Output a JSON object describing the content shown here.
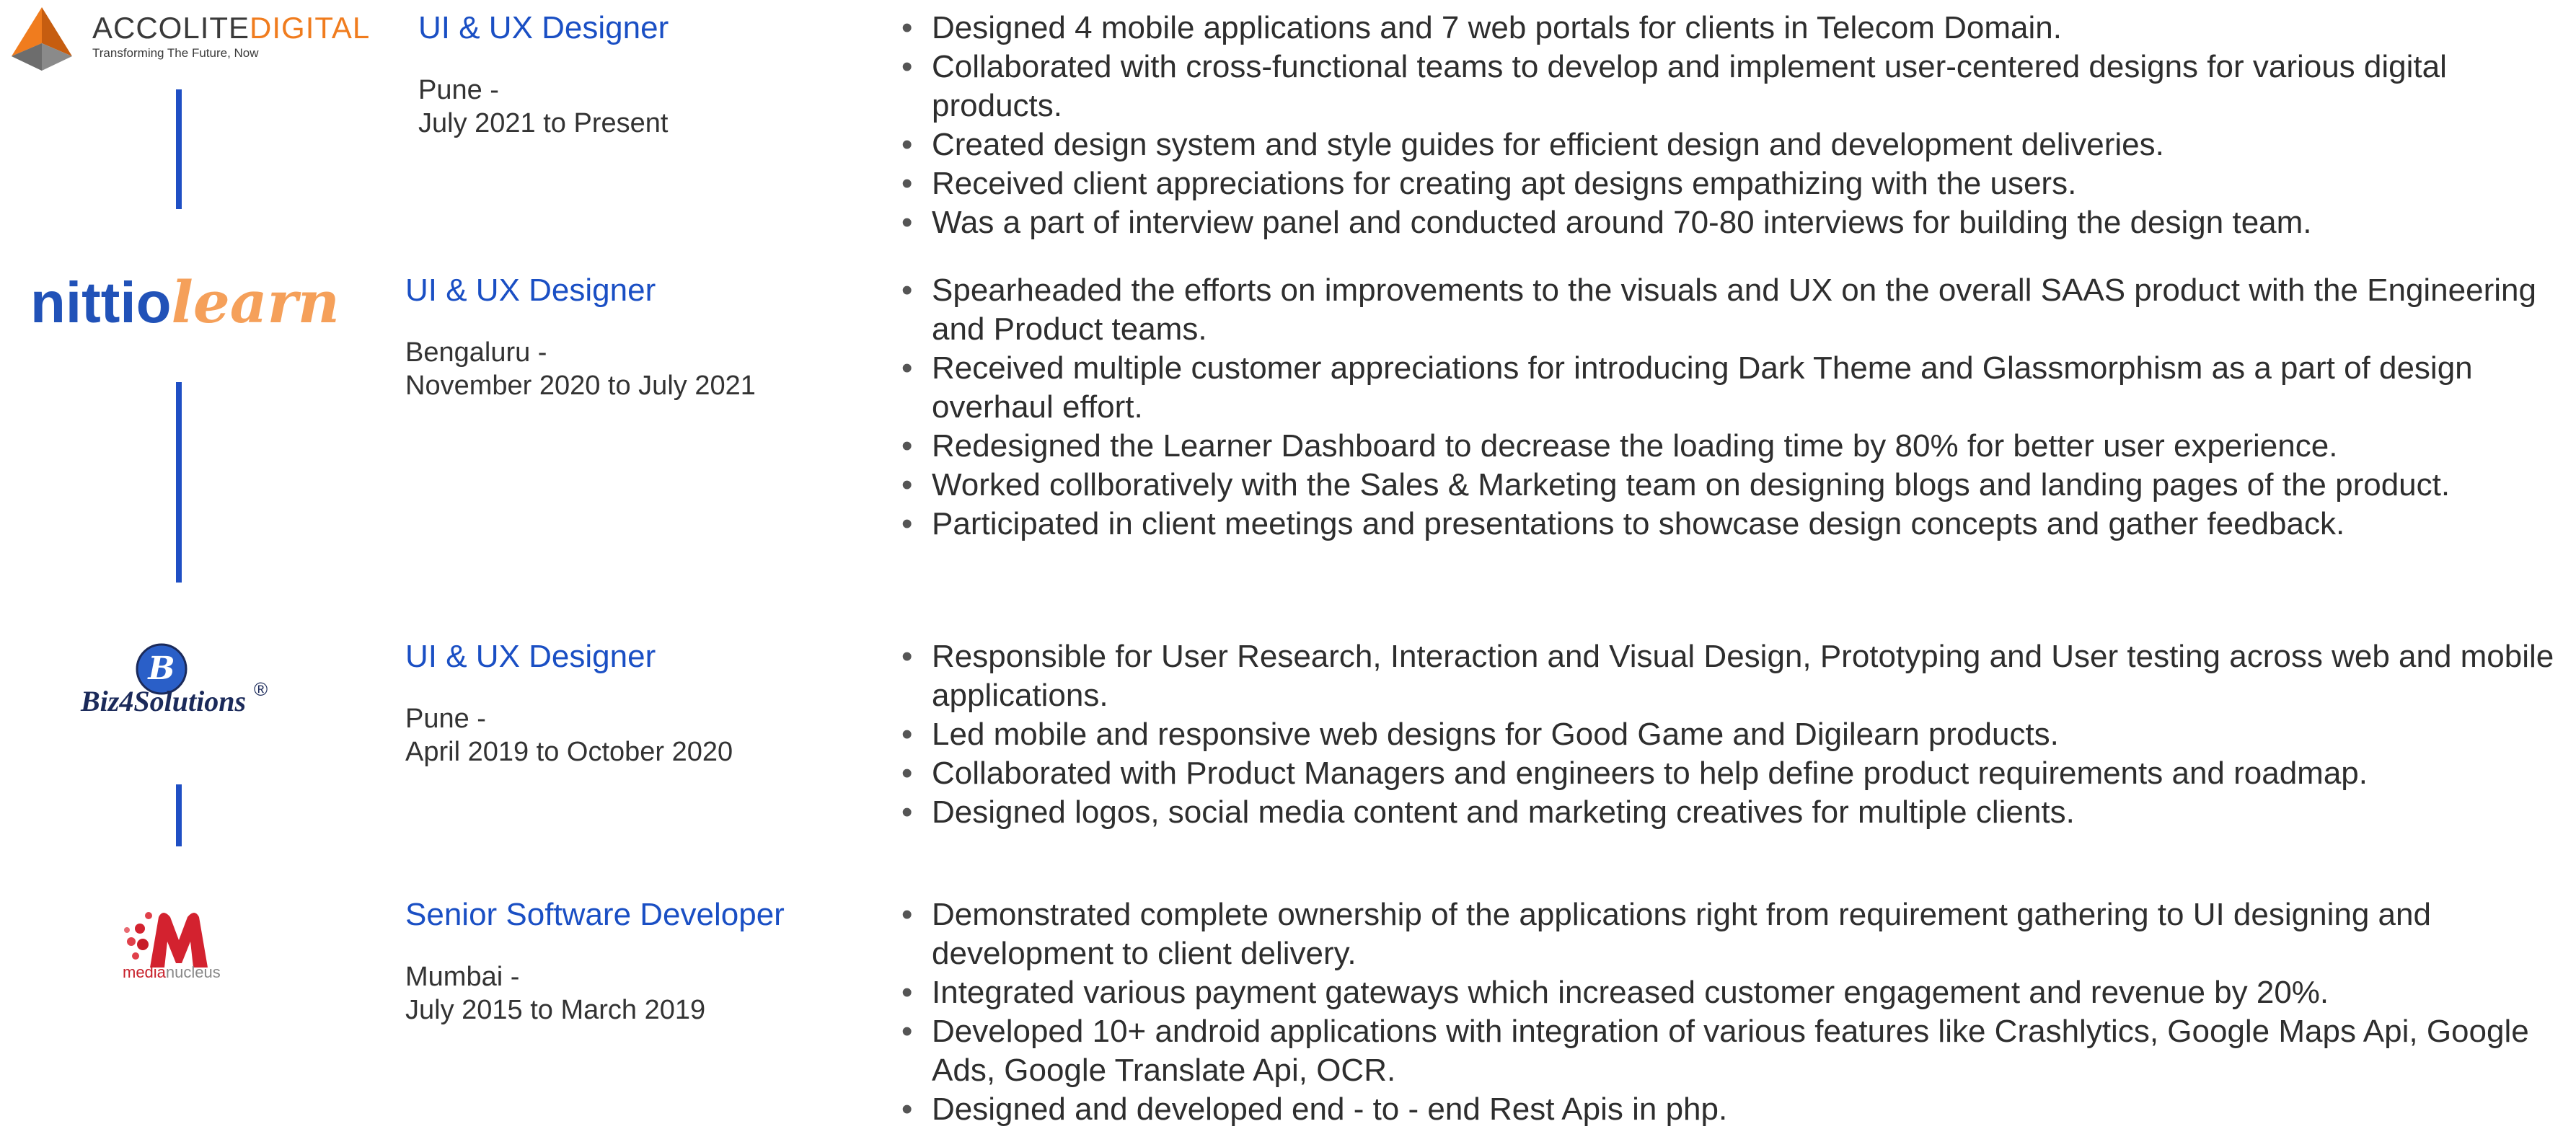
{
  "experience": [
    {
      "company": {
        "logo_name": "accolite-digital-logo",
        "name_part1": "ACCOLITE",
        "name_part2": "DIGITAL",
        "tagline": "Transforming The Future, Now",
        "colors": {
          "accent": "#f07c1e",
          "dark": "#3a3a3a"
        }
      },
      "role": "UI & UX Designer",
      "location": "Pune -",
      "period": "July 2021 to Present",
      "bullets": [
        "Designed 4 mobile applications and 7 web portals for clients in Telecom Domain.",
        "Collaborated with cross-functional teams to develop and implement user-centered designs for various digital products.",
        "Created design system and style guides for efficient design and development deliveries.",
        "Received client appreciations for creating apt designs empathizing with the users.",
        "Was a part of interview panel and conducted around 70-80 interviews for building the design team."
      ]
    },
    {
      "company": {
        "logo_name": "nittiolearn-logo",
        "name_part1": "nittio",
        "name_part2": "learn",
        "colors": {
          "primary": "#2152b8",
          "accent": "#f5a05a"
        }
      },
      "role": "UI & UX Designer",
      "location": "Bengaluru -",
      "period": "November 2020 to July 2021",
      "bullets": [
        "Spearheaded the efforts on improvements to the visuals and UX on the overall SAAS product with the Engineering and Product teams.",
        "Received multiple customer appreciations for introducing Dark Theme and Glassmorphism as a part of design overhaul effort.",
        "Redesigned the Learner Dashboard to decrease the loading time by 80% for better user experience.",
        "Worked collboratively with the Sales & Marketing team on designing blogs and landing pages of the product.",
        "Participated in client meetings and presentations to showcase design concepts and gather feedback."
      ]
    },
    {
      "company": {
        "logo_name": "biz4solutions-logo",
        "name": "Biz4Solutions",
        "registered": "®",
        "colors": {
          "primary": "#1b2a5a",
          "accent": "#2a5fc8"
        }
      },
      "role": "UI & UX Designer",
      "location": "Pune -",
      "period": "April 2019 to October 2020",
      "bullets": [
        "Responsible for User Research, Interaction and Visual Design, Prototyping and User testing across web and mobile applications.",
        "Led mobile and responsive web designs for Good Game and Digilearn products.",
        "Collaborated with Product Managers and engineers to help define product requirements and roadmap.",
        "Designed logos, social media content and marketing creatives for multiple clients."
      ]
    },
    {
      "company": {
        "logo_name": "medianucleus-logo",
        "name_part1": "media",
        "name_part2": "nucleus",
        "colors": {
          "primary": "#c8202a"
        }
      },
      "role": "Senior Software Developer",
      "location": "Mumbai -",
      "period": "July 2015 to March 2019",
      "bullets": [
        "Demonstrated complete ownership of the applications right from requirement gathering to UI designing and development to client delivery.",
        "Integrated various payment gateways which increased customer engagement and revenue by 20%.",
        "Developed 10+ android applications with integration of various features like Crashlytics, Google Maps Api, Google Ads, Google Translate Api, OCR.",
        "Designed and developed end - to - end Rest Apis in php."
      ]
    }
  ],
  "bullet_glyph": "•",
  "colors": {
    "role_text": "#1a4fc4",
    "timeline": "#1f4fc4",
    "body_text": "#2e2e2e"
  }
}
